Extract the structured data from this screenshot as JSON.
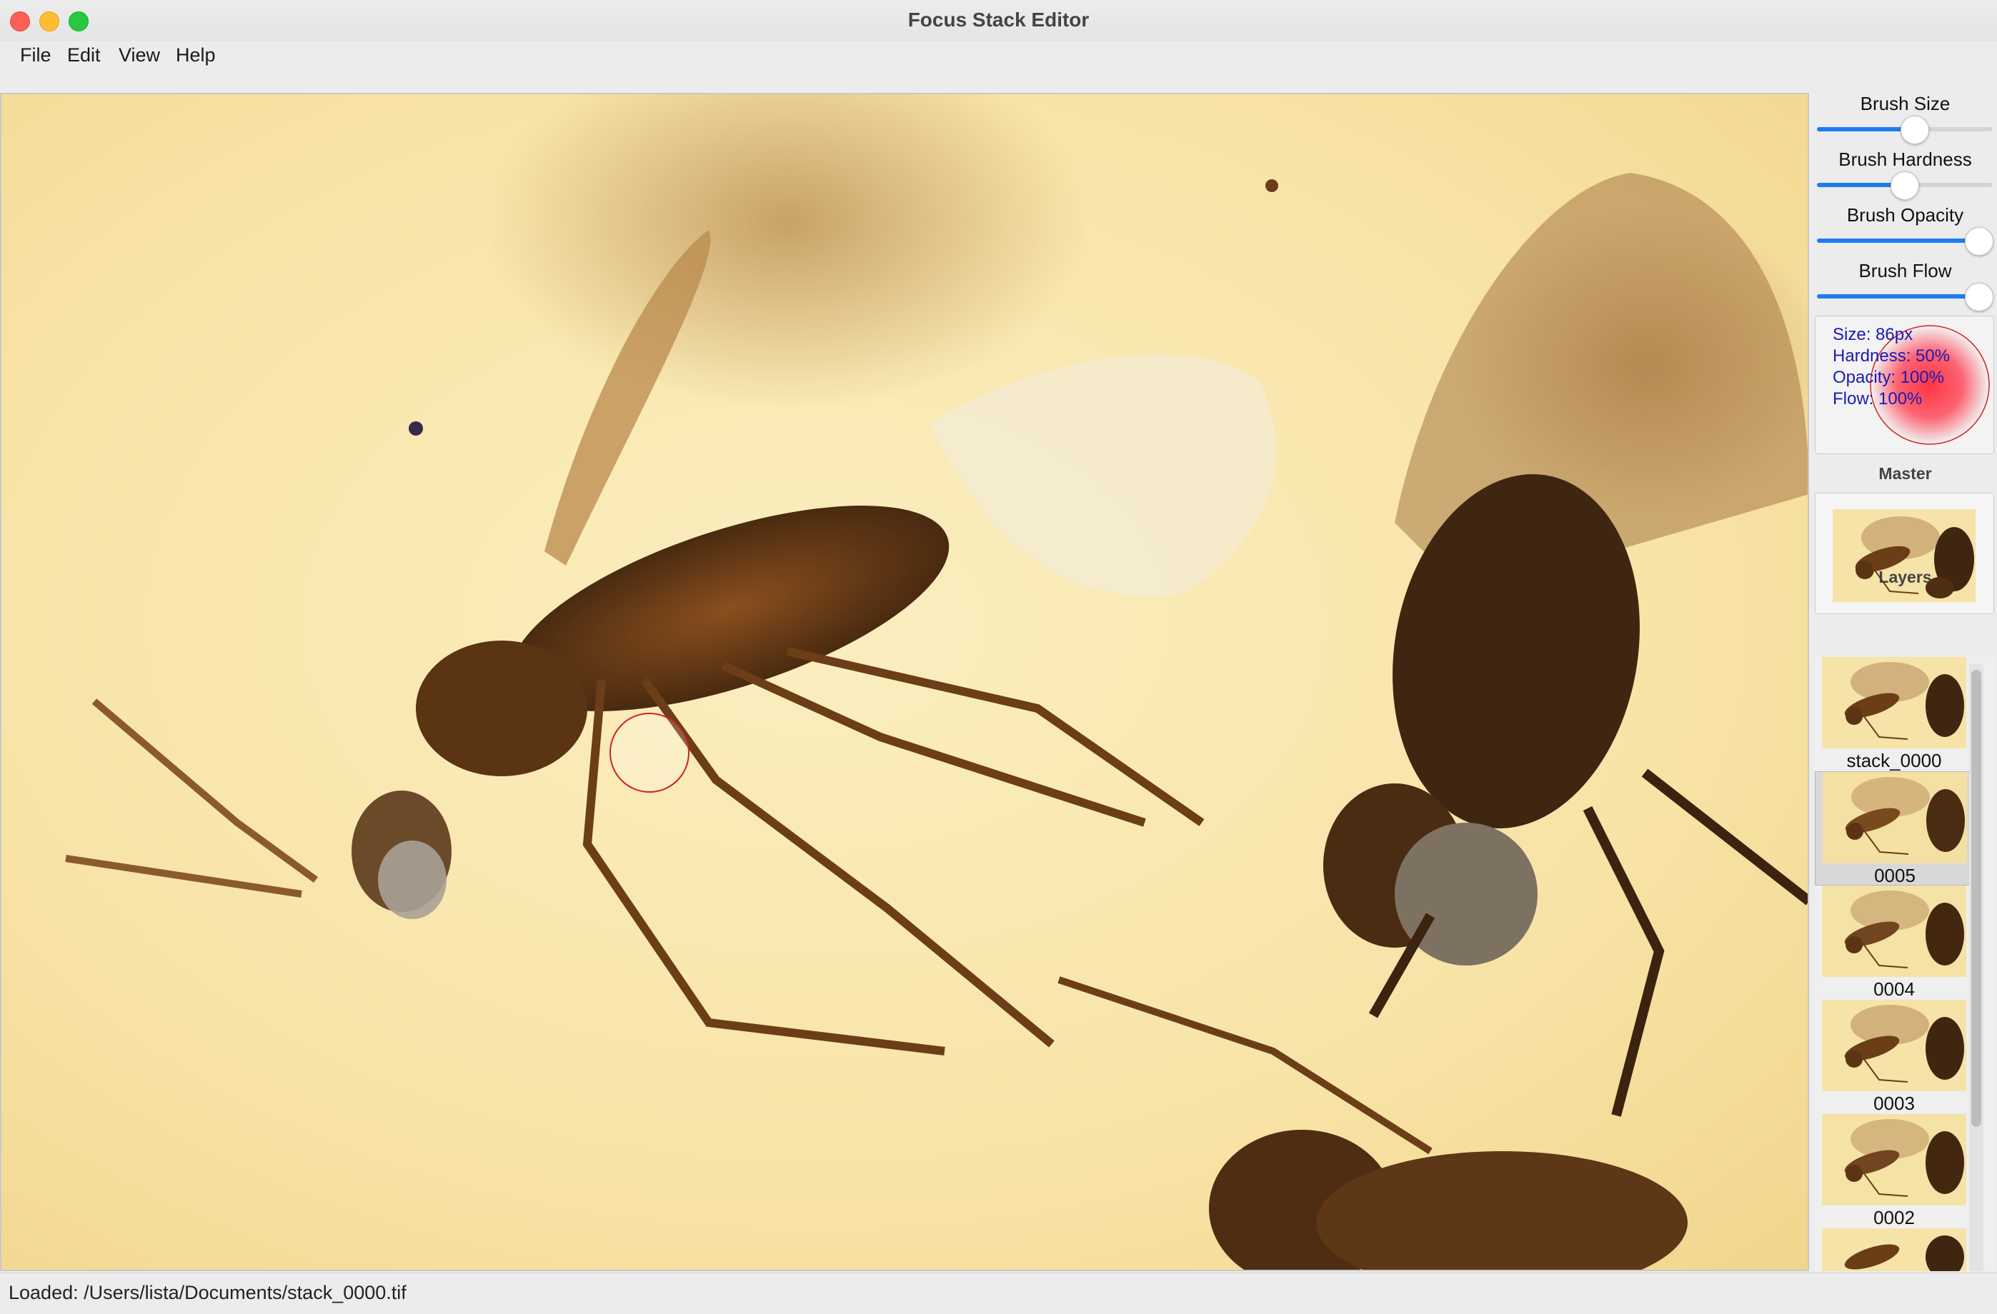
{
  "window": {
    "title": "Focus Stack Editor"
  },
  "menu": {
    "items": [
      "File",
      "Edit",
      "View",
      "Help"
    ]
  },
  "brush": {
    "sliders": [
      {
        "label": "Brush Size",
        "value_fraction": 0.5
      },
      {
        "label": "Brush Hardness",
        "value_fraction": 0.5
      },
      {
        "label": "Brush Opacity",
        "value_fraction": 1.0
      },
      {
        "label": "Brush Flow",
        "value_fraction": 1.0
      }
    ],
    "preview": {
      "size": "Size: 86px",
      "hardness": "Hardness: 50%",
      "opacity": "Opacity: 100%",
      "flow": "Flow: 100%"
    }
  },
  "master": {
    "title": "Master"
  },
  "layers": {
    "title": "Layers",
    "items": [
      {
        "label": "stack_0000",
        "selected": false
      },
      {
        "label": "0005",
        "selected": true
      },
      {
        "label": "0004",
        "selected": false
      },
      {
        "label": "0003",
        "selected": false
      },
      {
        "label": "0002",
        "selected": false
      }
    ]
  },
  "status": {
    "text": "Loaded: /Users/lista/Documents/stack_0000.tif"
  },
  "colors": {
    "accent": "#1e7cf2",
    "brush_cursor": "#d42020",
    "preview_text": "#1a1ab6"
  }
}
